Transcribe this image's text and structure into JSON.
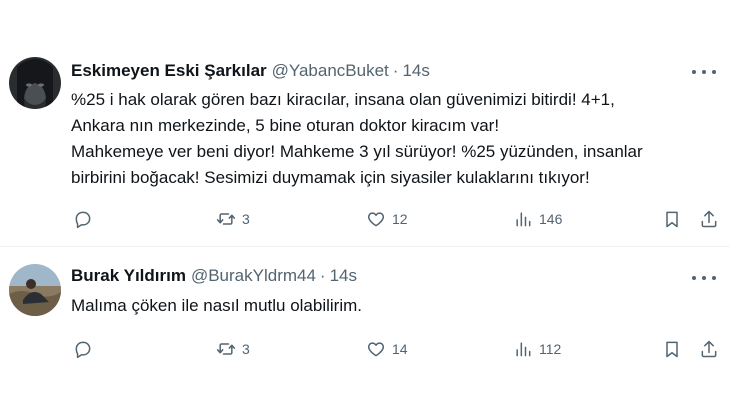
{
  "tweets": [
    {
      "author": {
        "display_name": "Eskimeyen Eski Şarkılar",
        "handle": "@YabancBuket",
        "avatar_icon": "dark-portrait-avatar"
      },
      "separator": "·",
      "time": "14s",
      "text_lines": [
        "%25 i hak olarak gören bazı kiracılar, insana olan güvenimizi bitirdi! 4+1,",
        "Ankara nın merkezinde, 5 bine oturan doktor kiracım var!",
        "Mahkemeye ver beni diyor! Mahkeme 3 yıl sürüyor! %25 yüzünden, insanlar",
        "birbirini boğacak!  Sesimizi duymamak için siyasiler kulaklarını tıkıyor!"
      ],
      "actions": {
        "reply_icon": "reply-icon",
        "retweet_count": "3",
        "like_count": "12",
        "view_count": "146"
      }
    },
    {
      "author": {
        "display_name": "Burak Yıldırım",
        "handle": "@BurakYldrm44",
        "avatar_icon": "outdoor-photo-avatar"
      },
      "separator": "·",
      "time": "14s",
      "text_lines": [
        "Malıma çöken ile nasıl mutlu olabilirim."
      ],
      "actions": {
        "reply_icon": "reply-icon",
        "retweet_count": "3",
        "like_count": "14",
        "view_count": "112"
      }
    }
  ],
  "colors": {
    "text_primary": "#0f1419",
    "text_secondary": "#536471",
    "divider": "#eff3f4"
  }
}
